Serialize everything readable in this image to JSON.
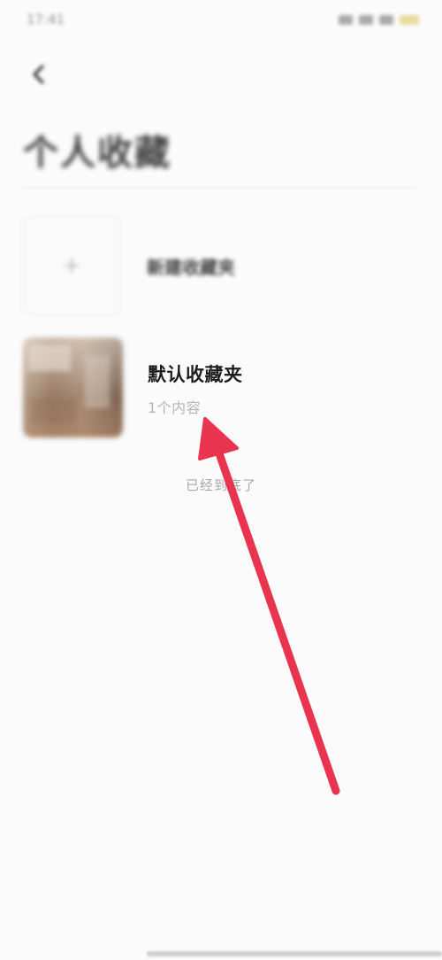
{
  "status_bar": {
    "time": "17:41"
  },
  "header": {
    "back_icon": "chevron-left-icon",
    "title": "个人收藏"
  },
  "new_folder": {
    "icon": "plus-icon",
    "label": "新建收藏夹"
  },
  "folders": [
    {
      "name": "默认收藏夹",
      "count_text": "1个内容"
    }
  ],
  "list_end_text": "已经到底了",
  "colors": {
    "annotation_arrow": "#e8344e",
    "battery": "#d9c14a"
  }
}
